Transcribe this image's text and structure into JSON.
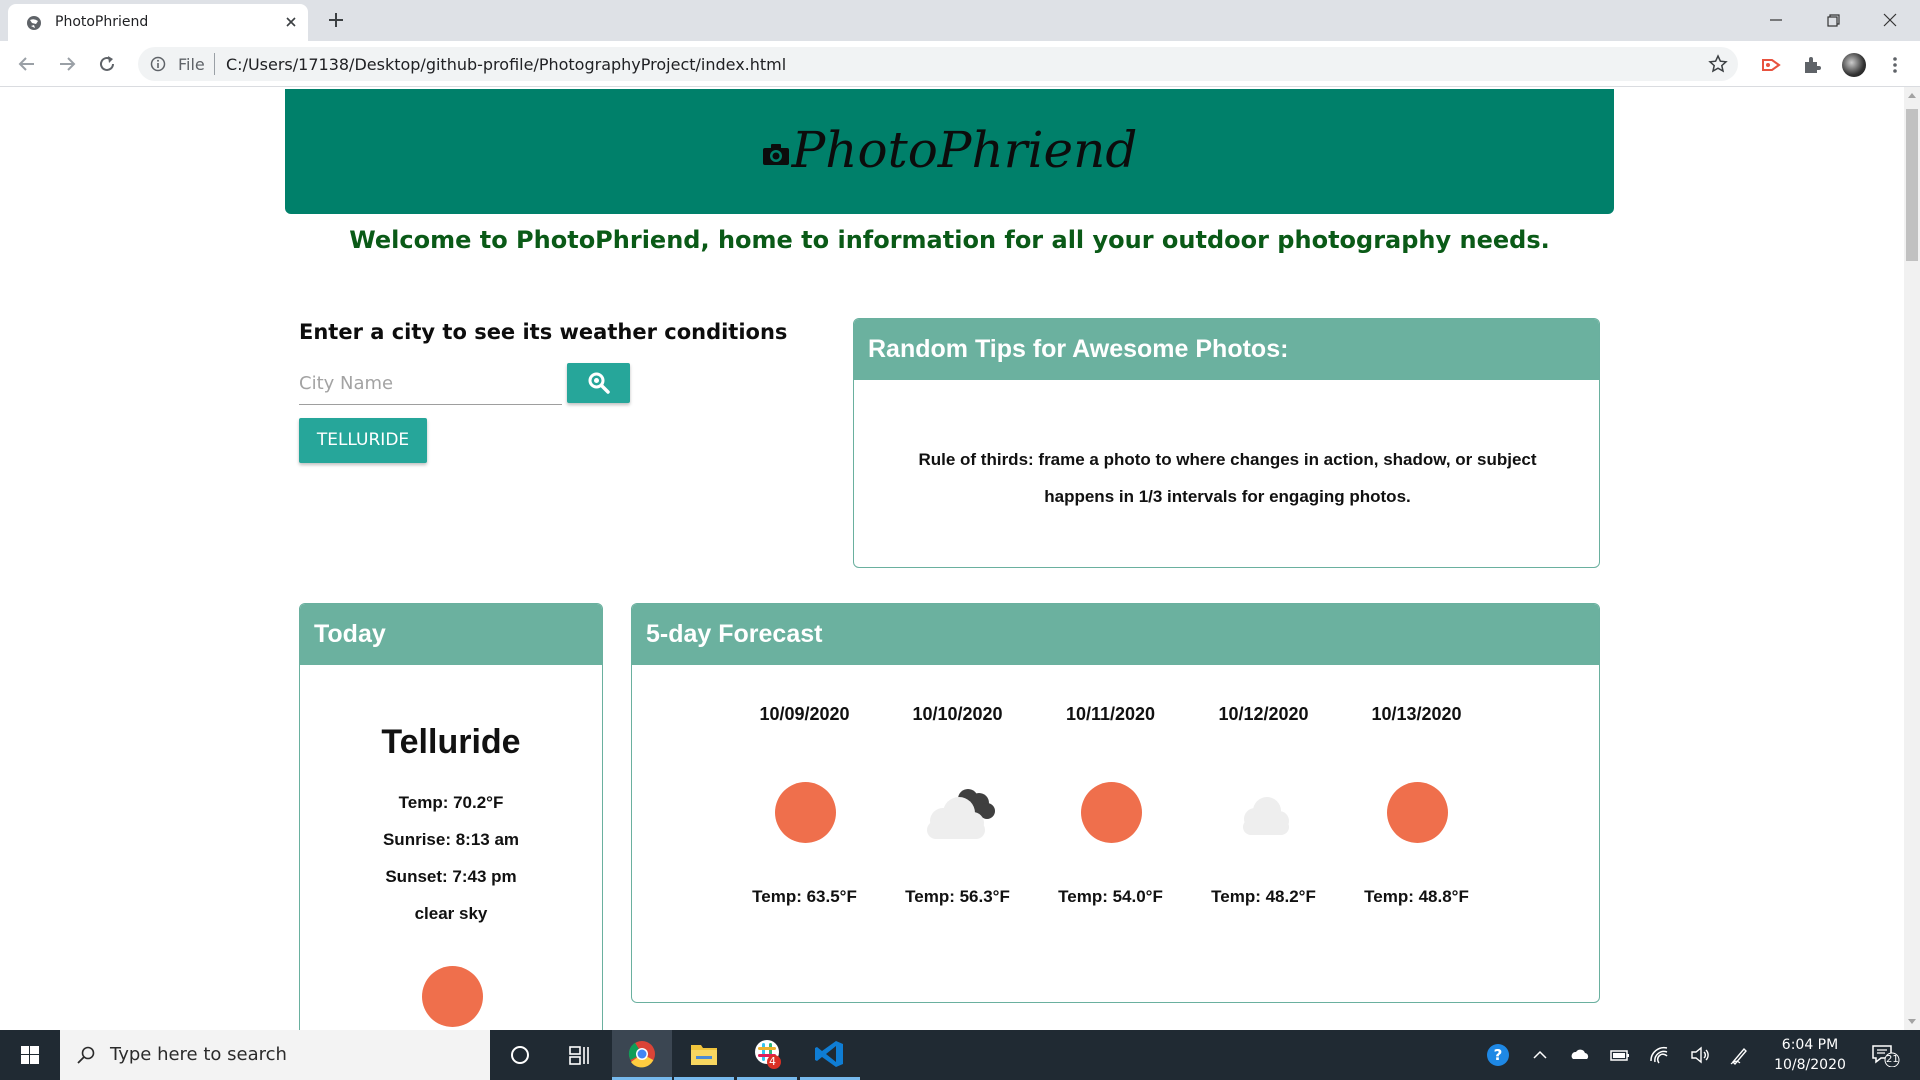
{
  "browser": {
    "tab_title": "PhotoPhriend",
    "url_scheme": "File",
    "url": "C:/Users/17138/Desktop/github-profile/PhotographyProject/index.html"
  },
  "page": {
    "brand": "PhotoPhriend",
    "welcome": "Welcome to PhotoPhriend, home to information for all your outdoor photography needs.",
    "search": {
      "heading": "Enter a city to see its weather conditions",
      "placeholder": "City Name",
      "history": [
        "TELLURIDE"
      ]
    },
    "tips": {
      "title": "Random Tips for Awesome Photos:",
      "text": "Rule of thirds: frame a photo to where changes in action, shadow, or subject happens in 1/3 intervals for engaging photos."
    },
    "today": {
      "title": "Today",
      "city": "Telluride",
      "temp": "Temp: 70.2°F",
      "sunrise": "Sunrise: 8:13 am",
      "sunset": "Sunset: 7:43 pm",
      "description": "clear sky",
      "icon": "sun-icon"
    },
    "forecast": {
      "title": "5-day Forecast",
      "days": [
        {
          "date": "10/09/2020",
          "icon": "sun-icon",
          "temp": "Temp: 63.5°F"
        },
        {
          "date": "10/10/2020",
          "icon": "broken-clouds-icon",
          "temp": "Temp: 56.3°F"
        },
        {
          "date": "10/11/2020",
          "icon": "sun-icon",
          "temp": "Temp: 54.0°F"
        },
        {
          "date": "10/12/2020",
          "icon": "cloud-icon",
          "temp": "Temp: 48.2°F"
        },
        {
          "date": "10/13/2020",
          "icon": "sun-icon",
          "temp": "Temp: 48.8°F"
        }
      ]
    }
  },
  "colors": {
    "hero": "#00806a",
    "card_header": "#6bb19f",
    "button": "#26a69a",
    "sun": "#ef6f4c",
    "welcome_text": "#0a5a17"
  },
  "taskbar": {
    "search_placeholder": "Type here to search",
    "time": "6:04 PM",
    "date": "10/8/2020",
    "notifications": "21",
    "slack_badge": "4"
  }
}
